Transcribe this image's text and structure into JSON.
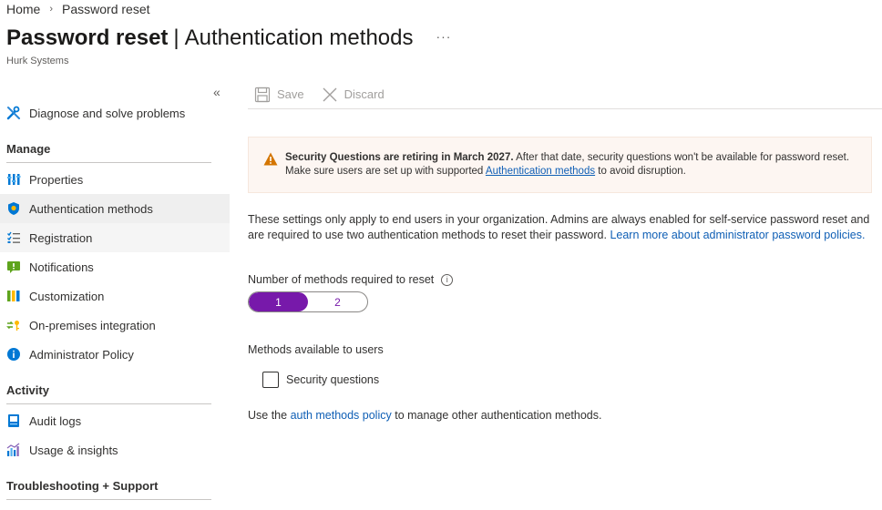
{
  "breadcrumb": {
    "home": "Home",
    "current": "Password reset",
    "separator": "›"
  },
  "header": {
    "title": "Password reset",
    "separator": "|",
    "subtitle": "Authentication methods",
    "more": "···",
    "org": "Hurk Systems"
  },
  "sidebar": {
    "collapse": "«",
    "top_items": [
      {
        "label": "Diagnose and solve problems",
        "icon": "wrench-icon"
      }
    ],
    "sections": [
      {
        "title": "Manage",
        "items": [
          {
            "label": "Properties",
            "icon": "properties-icon"
          },
          {
            "label": "Authentication methods",
            "icon": "shield-icon",
            "active": true
          },
          {
            "label": "Registration",
            "icon": "registration-list-icon"
          },
          {
            "label": "Notifications",
            "icon": "notification-icon"
          },
          {
            "label": "Customization",
            "icon": "customization-icon"
          },
          {
            "label": "On-premises integration",
            "icon": "sync-key-icon"
          },
          {
            "label": "Administrator Policy",
            "icon": "info-icon"
          }
        ]
      },
      {
        "title": "Activity",
        "items": [
          {
            "label": "Audit logs",
            "icon": "audit-log-icon"
          },
          {
            "label": "Usage & insights",
            "icon": "insights-chart-icon"
          }
        ]
      },
      {
        "title": "Troubleshooting + Support",
        "items": []
      }
    ]
  },
  "toolbar": {
    "save_label": "Save",
    "discard_label": "Discard"
  },
  "banner": {
    "bold": "Security Questions are retiring in March 2027.",
    "text_before": " After that date, security questions won't be available for password reset. Make sure users are set up with supported ",
    "link": "Authentication methods",
    "text_after": " to avoid disruption."
  },
  "description": {
    "text": "These settings only apply to end users in your organization. Admins are always enabled for self-service password reset and are required to use two authentication methods to reset their password. ",
    "link": "Learn more about administrator password policies."
  },
  "methods_required": {
    "label": "Number of methods required to reset",
    "info": "i",
    "options": [
      "1",
      "2"
    ],
    "selected": "1"
  },
  "methods_available": {
    "label": "Methods available to users",
    "checkbox_label": "Security questions",
    "checked": false
  },
  "footer": {
    "before": "Use the ",
    "link": "auth methods policy",
    "after": " to manage other authentication methods."
  },
  "colors": {
    "accent": "#7719aa",
    "link": "#0f5fb5",
    "warning": "#d47500"
  }
}
